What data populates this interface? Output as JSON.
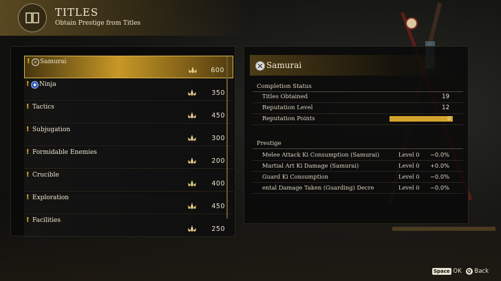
{
  "header": {
    "title": "TITLES",
    "subtitle": "Obtain Prestige from Titles",
    "icon": "titles-emblem-icon"
  },
  "titles_list": [
    {
      "name": "Samurai",
      "value": "600",
      "icon": "samurai-crest-icon",
      "selected": true
    },
    {
      "name": "Ninja",
      "value": "350",
      "icon": "ninja-crest-icon",
      "selected": false
    },
    {
      "name": "Tactics",
      "value": "450",
      "icon": null,
      "selected": false
    },
    {
      "name": "Subjugation",
      "value": "300",
      "icon": null,
      "selected": false
    },
    {
      "name": "Formidable Enemies",
      "value": "200",
      "icon": null,
      "selected": false
    },
    {
      "name": "Crucible",
      "value": "400",
      "icon": null,
      "selected": false
    },
    {
      "name": "Exploration",
      "value": "450",
      "icon": null,
      "selected": false
    },
    {
      "name": "Facilities",
      "value": "250",
      "icon": null,
      "selected": false
    }
  ],
  "detail": {
    "title": "Samurai",
    "completion_label": "Completion Status",
    "stats": [
      {
        "label": "Titles Obtained",
        "value": "19"
      },
      {
        "label": "Reputation Level",
        "value": "12"
      },
      {
        "label": "Reputation Points",
        "value": "0"
      }
    ],
    "reputation_progress": 1.0,
    "prestige_label": "Prestige",
    "prestige": [
      {
        "label": "Melee Attack Ki Consumption (Samurai)",
        "level": "Level 0",
        "pct": "−0.0%"
      },
      {
        "label": "Martial Art Ki Damage (Samurai)",
        "level": "Level 0",
        "pct": "+0.0%"
      },
      {
        "label": "Guard Ki Consumption",
        "level": "Level 0",
        "pct": "−0.0%"
      },
      {
        "label": "ental Damage Taken (Guarding)      Decre",
        "level": "Level 0",
        "pct": "−0.0%"
      }
    ]
  },
  "footer": {
    "ok_key": "Space",
    "ok_label": "OK",
    "back_key": "Q",
    "back_label": "Back"
  },
  "colors": {
    "accent_gold": "#d4a32c",
    "alert": "#f0b429"
  }
}
